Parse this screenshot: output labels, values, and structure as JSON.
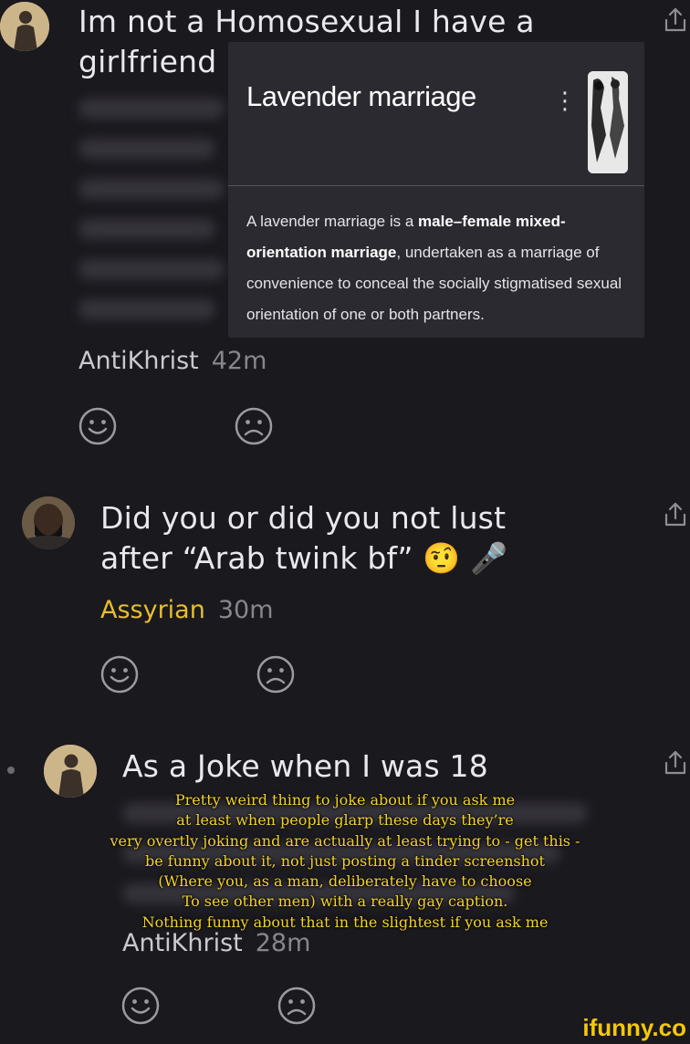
{
  "comments": [
    {
      "text": "Im not a Homosexual I have a girlfriend",
      "username": "AntiKhrist",
      "time": "42m"
    },
    {
      "text_line1": "Did you or did you not lust",
      "text_line2": "after “Arab twink bf”",
      "emojis": "🤨 🎤",
      "username": "Assyrian",
      "time": "30m"
    },
    {
      "text": "As a Joke when I was 18",
      "username": "AntiKhrist",
      "time": "28m"
    }
  ],
  "card": {
    "title": "Lavender marriage",
    "menu": "⋮",
    "body_pre": "A lavender marriage is a ",
    "body_bold": "male–female mixed-orientation marriage",
    "body_post": ", undertaken as a marriage of convenience to conceal the socially stigmatised sexual orientation of one or both partners."
  },
  "overlay_caption": [
    "Pretty weird thing to joke about if you ask me",
    "at least when people glarp these days they’re",
    "very overtly joking and are actually at least trying to - get this -",
    "be funny about it, not just posting a tinder screenshot",
    "(Where you, as a man, deliberately have to choose",
    "To see other men) with a really gay caption.",
    "Nothing funny about that in the slightest if you ask me"
  ],
  "watermark": "ifunny.co",
  "colors": {
    "background": "#1a191e",
    "username_gold": "#e9bd2d",
    "caption_yellow": "#f3d22a"
  },
  "icons": [
    "share-icon",
    "smile-icon",
    "frown-icon",
    "avatar"
  ]
}
